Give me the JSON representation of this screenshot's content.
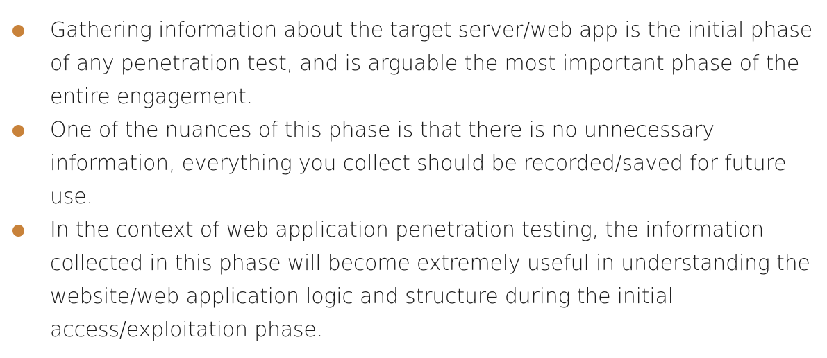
{
  "accent_color": "#c8823a",
  "bullets": [
    {
      "icon": "bullet-dot-icon",
      "text": "Gathering information about the target server/web app is the initial phase of any penetration test, and is arguable the most important phase of the entire engagement."
    },
    {
      "icon": "bullet-dot-icon",
      "text": "One of the nuances of this phase is that there is no unnecessary information, everything you collect should be recorded/saved for future use."
    },
    {
      "icon": "bullet-dot-icon",
      "text": "In the context of web application penetration testing, the information collected in this phase will become extremely useful in understanding the website/web application logic and structure during the initial access/exploitation phase."
    }
  ]
}
